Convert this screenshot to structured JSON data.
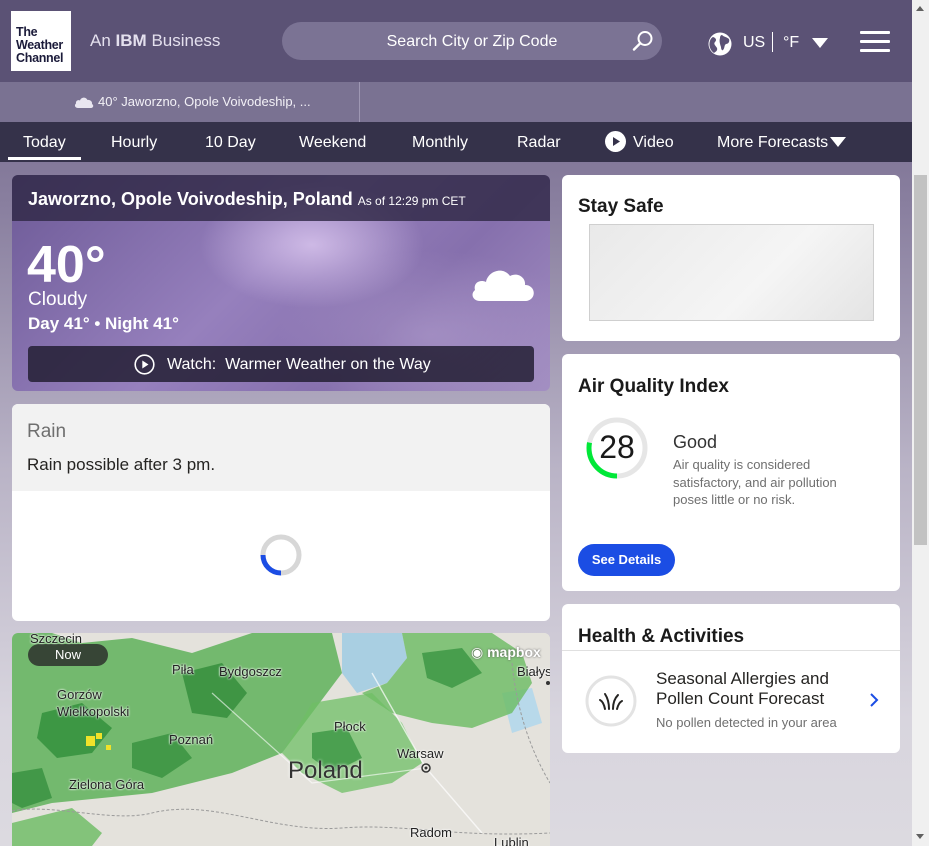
{
  "header": {
    "logo_lines": [
      "The",
      "Weather",
      "Channel"
    ],
    "ibm_prefix": "An",
    "ibm_brand": "IBM",
    "ibm_suffix": "Business",
    "search_placeholder": "Search City or Zip Code",
    "locale": "US",
    "unit": "°F"
  },
  "recent": {
    "label": "40° Jaworzno, Opole Voivodeship, ..."
  },
  "nav": {
    "items": [
      "Today",
      "Hourly",
      "10 Day",
      "Weekend",
      "Monthly",
      "Radar",
      "Video",
      "More Forecasts"
    ],
    "active": "Today"
  },
  "current": {
    "location": "Jaworzno, Opole Voivodeship, Poland",
    "as_of": "As of 12:29 pm CET",
    "temp": "40°",
    "phrase": "Cloudy",
    "day_night": "Day 41° • Night 41°",
    "watch_label": "Watch:",
    "watch_title": "Warmer Weather on the Way"
  },
  "rain": {
    "title": "Rain",
    "desc": "Rain possible after 3 pm."
  },
  "map": {
    "now": "Now",
    "attribution": "mapbox",
    "country": "Poland",
    "cities": [
      "Szczecin",
      "Bydgoszcz",
      "Białystok",
      "Gorzów Wielkopolski",
      "Piła",
      "Poznań",
      "Płock",
      "Warsaw",
      "Zielona Góra",
      "Radom",
      "Lublin"
    ]
  },
  "stay_safe": {
    "title": "Stay Safe"
  },
  "aqi": {
    "title": "Air Quality Index",
    "value": "28",
    "fill_fraction": 0.28,
    "category": "Good",
    "description": "Air quality is considered satisfactory, and air pollution poses little or no risk.",
    "button": "See Details",
    "color": "#00e838"
  },
  "health": {
    "title": "Health & Activities",
    "item_title": "Seasonal Allergies and Pollen Count Forecast",
    "item_sub": "No pollen detected in your area"
  }
}
